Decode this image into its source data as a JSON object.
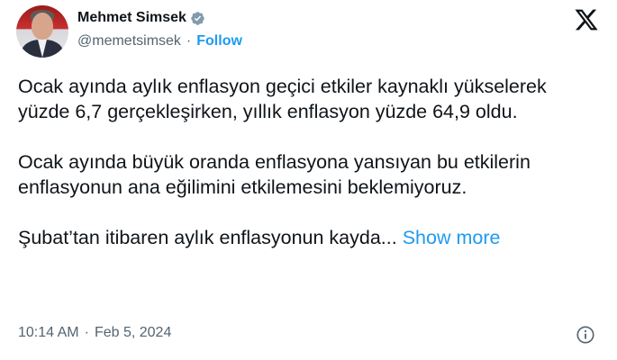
{
  "author": {
    "display_name": "Mehmet Simsek",
    "handle": "@memetsimsek",
    "separator": "·",
    "follow_label": "Follow",
    "verified_icon": "verified-badge-icon",
    "verified_color": "#829aab"
  },
  "tweet": {
    "paragraphs": [
      "Ocak ayında aylık enflasyon geçici etkiler kaynaklı yükselerek yüzde 6,7 gerçekleşirken, yıllık enflasyon yüzde 64,9 oldu.",
      "Ocak ayında büyük oranda enflasyona yansıyan bu etkilerin enflasyonun ana eğilimini etkilemesini beklemiyoruz."
    ],
    "truncated_text": "Şubat’tan itibaren aylık enflasyonun kayda...",
    "show_more_label": "Show more",
    "time": "10:14 AM",
    "meta_separator": "·",
    "date": "Feb 5, 2024"
  },
  "icons": {
    "platform": "x-logo-icon",
    "info": "info-icon"
  },
  "colors": {
    "link": "#1d9bf0",
    "secondary_text": "#536471",
    "primary_text": "#0f1419"
  }
}
